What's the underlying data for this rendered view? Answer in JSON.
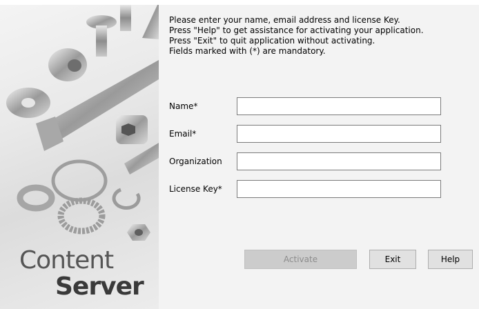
{
  "sidebar": {
    "brand_line1": "Content",
    "brand_line2": "Server"
  },
  "instructions": [
    "Please enter your name, email address and license Key.",
    "Press \"Help\" to get assistance for activating your application.",
    "Press \"Exit\" to quit application without activating.",
    "Fields marked with (*) are mandatory."
  ],
  "form": {
    "name_label": "Name*",
    "name_value": "",
    "email_label": "Email*",
    "email_value": "",
    "organization_label": "Organization",
    "organization_value": "",
    "license_label": "License Key*",
    "license_value": ""
  },
  "buttons": {
    "activate": "Activate",
    "exit": "Exit",
    "help": "Help"
  }
}
